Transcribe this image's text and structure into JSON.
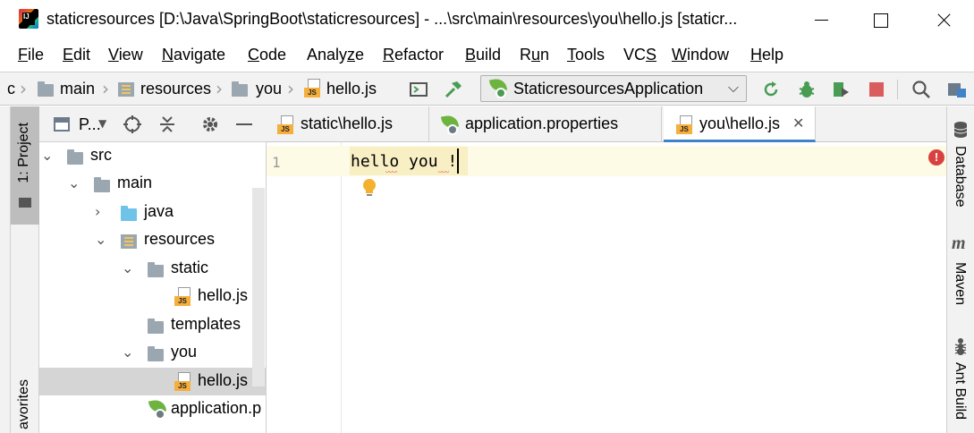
{
  "window": {
    "title": "staticresources [D:\\Java\\SpringBoot\\staticresources] - ...\\src\\main\\resources\\you\\hello.js [staticr..."
  },
  "menu": [
    {
      "label": "File",
      "mnemonic": "F",
      "rest": "ile"
    },
    {
      "label": "Edit",
      "mnemonic": "E",
      "rest": "dit"
    },
    {
      "label": "View",
      "mnemonic": "V",
      "rest": "iew"
    },
    {
      "label": "Navigate",
      "mnemonic": "N",
      "rest": "avigate"
    },
    {
      "label": "Code",
      "mnemonic": "C",
      "rest": "ode"
    },
    {
      "label": "Analyze",
      "pre": "Analy",
      "mnemonic": "z",
      "rest": "e"
    },
    {
      "label": "Refactor",
      "mnemonic": "R",
      "rest": "efactor"
    },
    {
      "label": "Build",
      "mnemonic": "B",
      "rest": "uild"
    },
    {
      "label": "Run",
      "pre": "R",
      "mnemonic": "u",
      "rest": "n"
    },
    {
      "label": "Tools",
      "mnemonic": "T",
      "rest": "ools"
    },
    {
      "label": "VCS",
      "mnemonic": "S",
      "pre": "VC",
      "rest": ""
    },
    {
      "label": "Window",
      "mnemonic": "W",
      "rest": "indow"
    },
    {
      "label": "Help",
      "mnemonic": "H",
      "rest": "elp"
    }
  ],
  "breadcrumb": {
    "items": [
      "c",
      "main",
      "resources",
      "you",
      "hello.js"
    ]
  },
  "run_config": {
    "label": "StaticresourcesApplication"
  },
  "left_stripe": {
    "project_label": "1: Project",
    "favorites_label": "avorites"
  },
  "project_panel": {
    "title": "P...",
    "tree": [
      {
        "label": "src",
        "level": 0,
        "expanded": true,
        "icon": "folder-icon"
      },
      {
        "label": "main",
        "level": 1,
        "expanded": true,
        "icon": "folder-icon"
      },
      {
        "label": "java",
        "level": 2,
        "expanded": false,
        "icon": "java-folder-icon"
      },
      {
        "label": "resources",
        "level": 2,
        "expanded": true,
        "icon": "resources-folder-icon"
      },
      {
        "label": "static",
        "level": 3,
        "expanded": true,
        "icon": "folder-icon"
      },
      {
        "label": "hello.js",
        "level": 4,
        "icon": "js-file-icon"
      },
      {
        "label": "templates",
        "level": 3,
        "icon": "folder-icon"
      },
      {
        "label": "you",
        "level": 3,
        "expanded": true,
        "icon": "folder-icon"
      },
      {
        "label": "hello.js",
        "level": 4,
        "icon": "js-file-icon",
        "selected": true
      },
      {
        "label": "application.p",
        "level": 3,
        "icon": "spring-properties-icon"
      }
    ]
  },
  "editor_tabs": [
    {
      "label": "static\\hello.js",
      "icon": "js-file-icon",
      "active": false
    },
    {
      "label": "application.properties",
      "icon": "spring-properties-icon",
      "active": false
    },
    {
      "label": "you\\hello.js",
      "icon": "js-file-icon",
      "active": true,
      "closable": true
    }
  ],
  "editor": {
    "line_number": "1",
    "code": "hello you !"
  },
  "right_stripe": {
    "database": "Database",
    "maven": "Maven",
    "maven_glyph": "m",
    "ant": "Ant Build"
  },
  "colors": {
    "accent": "#4083c9",
    "run_green": "#499c54",
    "stop_red": "#db5c5c",
    "js_badge": "#f4af3d",
    "spring_green": "#6db33f",
    "error_red": "#d94141"
  }
}
